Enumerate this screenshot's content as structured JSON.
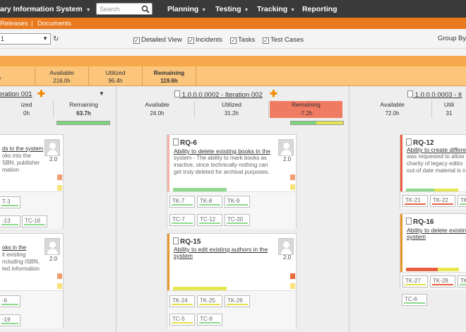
{
  "header": {
    "app_title": "ary Information System",
    "search_placeholder": "Search",
    "nav": [
      "Planning",
      "Testing",
      "Tracking",
      "Reporting"
    ]
  },
  "subnav": {
    "releases": "Releases",
    "sep": "|",
    "documents": "Documents"
  },
  "toolbar": {
    "release_select": "1",
    "filters": [
      "Detailed View",
      "Incidents",
      "Tasks",
      "Test Cases"
    ],
    "group_by": "Group By"
  },
  "release_summary": {
    "link": "1",
    "available_label": "Available",
    "available_value": "216.0h",
    "utilized_label": "Utilized",
    "utilized_value": "96.4h",
    "remaining_label": "Remaining",
    "remaining_value": "119.6h"
  },
  "iterations": [
    {
      "title": "eration 001",
      "utilized_label": "ized",
      "utilized_value": "0h",
      "remaining_label": "Remaining",
      "remaining_value": "63.7h"
    },
    {
      "title": "1.0.0.0.0002 - Iteration 002",
      "available_label": "Available",
      "available_value": "24.0h",
      "utilized_label": "Utilized",
      "utilized_value": "31.2h",
      "remaining_label": "Remaining",
      "remaining_value": "-7.2h"
    },
    {
      "title": "1.0.0.0.0003 - It",
      "available_label": "Available",
      "available_value": "72.0h",
      "utilized_label": "Utili",
      "utilized_value": "31"
    }
  ],
  "cards_col1": [
    {
      "lines": [
        "ds to the system",
        "oks into the",
        "SBN, publisher",
        "mation"
      ],
      "estimate": "2.0",
      "tests": [
        "T-3",
        "-13",
        "TC-16"
      ]
    },
    {
      "lines": [
        "oks in the",
        "it existing",
        "ncluding ISBN,",
        "ted information"
      ],
      "estimate": "2.0",
      "tests": [
        "-6",
        "-19"
      ]
    }
  ],
  "cards_col2": [
    {
      "id": "RQ-6",
      "name": "Ability to delete existing books in the",
      "desc": [
        "system - The ability to mark books as",
        "inactive, since technically nothing can",
        "get truly deleted for archival purposes."
      ],
      "estimate": "2.0",
      "tests": [
        "TK-7",
        "TK-8",
        "TK-9",
        "TC-7",
        "TC-12",
        "TC-20"
      ]
    },
    {
      "id": "RQ-15",
      "name": "Ability to edit existing authors in the",
      "name2": "system",
      "estimate": "2.0",
      "tests": [
        "TK-24",
        "TK-25",
        "TK-26",
        "TC-5",
        "TC-9"
      ]
    }
  ],
  "cards_col3": [
    {
      "id": "RQ-12",
      "name": "Ability to create differe",
      "desc": [
        "was requested to allow",
        "charity of legacy editio",
        "out-of date material is n"
      ],
      "tests": [
        "TK-21",
        "TK-22",
        "TK-"
      ]
    },
    {
      "id": "RQ-16",
      "name": "Ability to delete existin",
      "name2": "system",
      "tests": [
        "TK-27",
        "TK-28",
        "TK-",
        "TC-6"
      ]
    }
  ],
  "colors": {
    "accent_orange": "#e8791c",
    "summary_bg": "#fbc57c",
    "negative": "#f07b63"
  }
}
